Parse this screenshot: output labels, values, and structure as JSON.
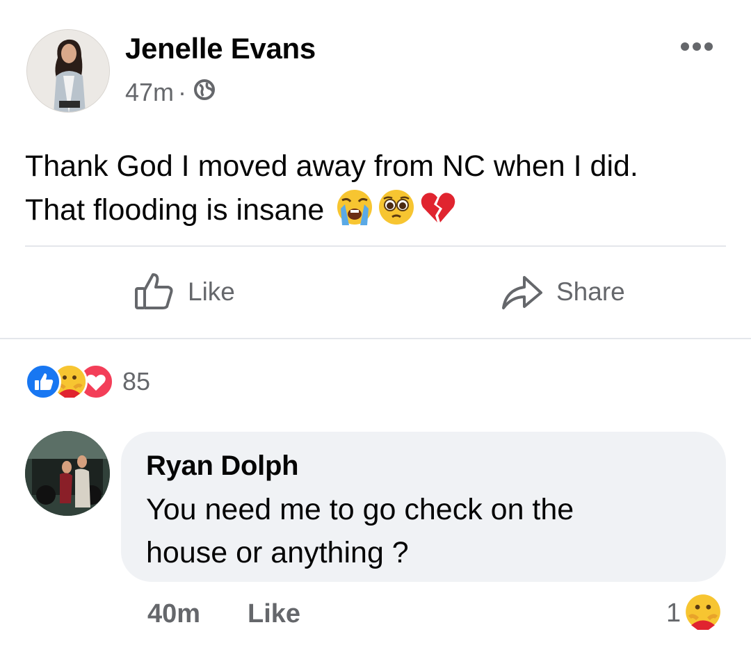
{
  "post": {
    "author": "Jenelle Evans",
    "time": "47m",
    "separator": "·",
    "privacy_icon": "globe-icon",
    "more_icon": "more-options-icon",
    "text_line1": "Thank God I moved away from NC when I did.",
    "text_line2": "That flooding is insane",
    "emojis": [
      "crying-face",
      "pleading-face",
      "broken-heart"
    ]
  },
  "actions": {
    "like_label": "Like",
    "share_label": "Share"
  },
  "reactions": {
    "types": [
      "like",
      "care",
      "love"
    ],
    "count": "85"
  },
  "comment": {
    "author": "Ryan Dolph",
    "text_line1": "You need me to go check on the",
    "text_line2": "house or anything ?",
    "time": "40m",
    "like_label": "Like",
    "reaction_count": "1",
    "reaction_type": "care"
  },
  "colors": {
    "secondary_text": "#65676b",
    "like_blue": "#1877f2",
    "love_red": "#f33e58",
    "bubble_bg": "#f0f2f5"
  }
}
